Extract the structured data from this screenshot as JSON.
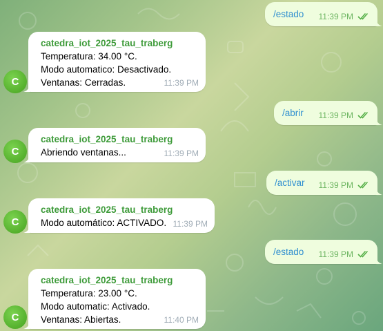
{
  "chat": {
    "bot_name": "catedra_iot_2025_tau_traberg",
    "avatar_letter": "C",
    "messages": [
      {
        "direction": "out",
        "text": "/estado",
        "time": "11:39 PM"
      },
      {
        "direction": "in",
        "lines": [
          "Temperatura: 34.00 °C.",
          "Modo automatico: Desactivado.",
          "Ventanas: Cerradas."
        ],
        "time": "11:39 PM"
      },
      {
        "direction": "out",
        "text": "/abrir",
        "time": "11:39 PM"
      },
      {
        "direction": "in",
        "lines": [
          "Abriendo ventanas..."
        ],
        "time": "11:39 PM"
      },
      {
        "direction": "out",
        "text": "/activar",
        "time": "11:39 PM"
      },
      {
        "direction": "in",
        "lines": [
          "Modo automático: ACTIVADO."
        ],
        "time": "11:39 PM"
      },
      {
        "direction": "out",
        "text": "/estado",
        "time": "11:39 PM"
      },
      {
        "direction": "in",
        "lines": [
          "Temperatura: 23.00 °C.",
          "Modo automatic: Activado.",
          "Ventanas: Abiertas."
        ],
        "time": "11:40 PM"
      }
    ]
  },
  "colors": {
    "incoming_bubble": "#ffffff",
    "outgoing_bubble": "#effdde",
    "sender_name": "#3e9b3a",
    "command_link": "#2f8fd0",
    "outgoing_time": "#6db561",
    "avatar": "#4caf28"
  }
}
